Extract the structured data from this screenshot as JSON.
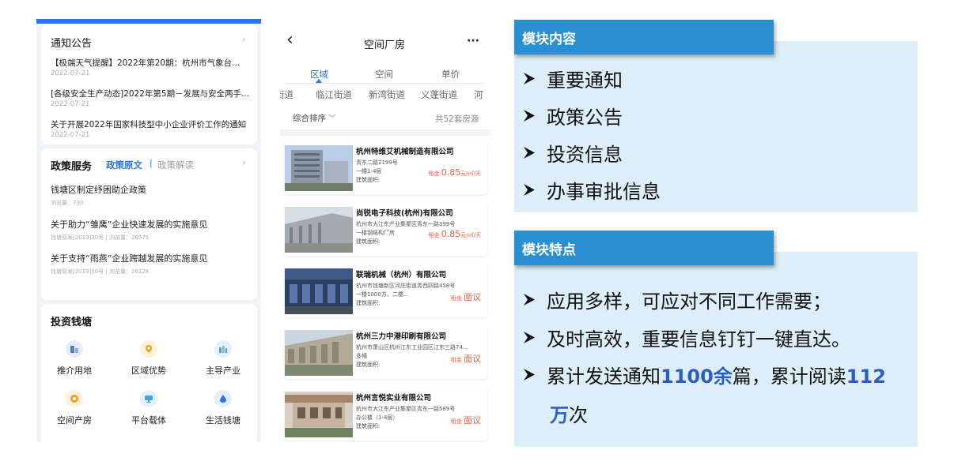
{
  "notice": {
    "title": "通知公告",
    "items": [
      {
        "title": "【极端天气提醒】2022年第20期：杭州市气象台...",
        "date": "2022-07-21"
      },
      {
        "title": "[各级安全生产动态]2022年第5期－发展与安全两手...",
        "date": "2022-07-21"
      },
      {
        "title": "关于开展2022年国家科技型中小企业评价工作的通知",
        "date": "2022-07-21"
      }
    ]
  },
  "policy": {
    "title": "政策服务",
    "tab_active": "政策原文",
    "separator": "|",
    "tab_inactive": "政策解读",
    "items": [
      {
        "title": "钱塘区制定纾困助企政策",
        "meta": "浏览量：730"
      },
      {
        "title": "关于助力“雏鹰”企业快速发展的实施意见",
        "meta": "钱塘管发[2019]30号   |   浏览量：26575"
      },
      {
        "title": "关于支持“雨燕”企业跨越发展的实施意见",
        "meta": "钱塘管发[2019]30号   |   浏览量：26128"
      }
    ]
  },
  "invest": {
    "title": "投资钱塘",
    "items": [
      {
        "label": "推介用地",
        "icon": "building-icon",
        "color": "#4a7fd6"
      },
      {
        "label": "区域优势",
        "icon": "location-pin-icon",
        "color": "#f0a020"
      },
      {
        "label": "主导产业",
        "icon": "industry-icon",
        "color": "#4aa0e0"
      },
      {
        "label": "空间产房",
        "icon": "circle-dot-icon",
        "color": "#f0a020"
      },
      {
        "label": "平台载体",
        "icon": "monitor-icon",
        "color": "#4aa0e0"
      },
      {
        "label": "生活钱塘",
        "icon": "water-drop-icon",
        "color": "#2a73e8"
      }
    ]
  },
  "space": {
    "back": "‹",
    "title": "空间厂房",
    "more": "···",
    "tabs": [
      "区域",
      "空间",
      "单价"
    ],
    "streets": [
      "街道",
      "临江街道",
      "新湾街道",
      "义蓬街道",
      "河"
    ],
    "sort": "综合排序",
    "count": "共52套房源",
    "listings": [
      {
        "name": "杭州特维艾机械制造有限公司",
        "addr": "青东二路2199号",
        "spec": "一幢1-4层",
        "area": "建筑面积:",
        "rent_label": "租金",
        "rent": "0.85",
        "unit": "元/㎡/天"
      },
      {
        "name": "尚锐电子科技(杭州)有限公司",
        "addr": "杭州市大江东产业集聚区青东一路399号",
        "spec": "一楼钢结构厂房",
        "area": "建筑面积:",
        "rent_label": "租金",
        "rent": "0.85",
        "unit": "元/㎡/天"
      },
      {
        "name": "联瑞机械（杭州）有限公司",
        "addr": "杭州市钱塘新区河庄街道青西四路458号",
        "spec": "一楼1000方、二楼...",
        "area": "建筑面积:",
        "rent_label": "租金",
        "rent": "面议",
        "unit": ""
      },
      {
        "name": "杭州三力中港印刷有限公司",
        "addr": "杭州市萧山区杭州江东工业园区江东三路74...",
        "spec": "多幢",
        "area": "建筑面积:",
        "rent_label": "租金",
        "rent": "面议",
        "unit": ""
      },
      {
        "name": "杭州言悦实业有限公司",
        "addr": "杭州市大江东产业集聚区青东一路589号",
        "spec": "办公楼（1-4层）",
        "area": "建筑面积:",
        "rent_label": "租金",
        "rent": "面议",
        "unit": ""
      }
    ]
  },
  "module_content": {
    "heading": "模块内容",
    "bullets": [
      "重要通知",
      "政策公告",
      "投资信息",
      "办事审批信息"
    ]
  },
  "module_features": {
    "heading": "模块特点",
    "b1": "应用多样，可应对不同工作需要；",
    "b2": "及时高效，重要信息钉钉一键直达。",
    "b3_pre": "累计发送通知",
    "b3_num1": "1100余",
    "b3_mid": "篇，累计阅读",
    "b3_num2": "112",
    "b4_num": "万",
    "b4_post": "次"
  },
  "colors": {
    "accent": "#2a8fd0",
    "panel": "#ddeef8",
    "highlight": "#2a5ec2",
    "rent": "#e85d3a",
    "app_blue": "#2a73e8"
  }
}
